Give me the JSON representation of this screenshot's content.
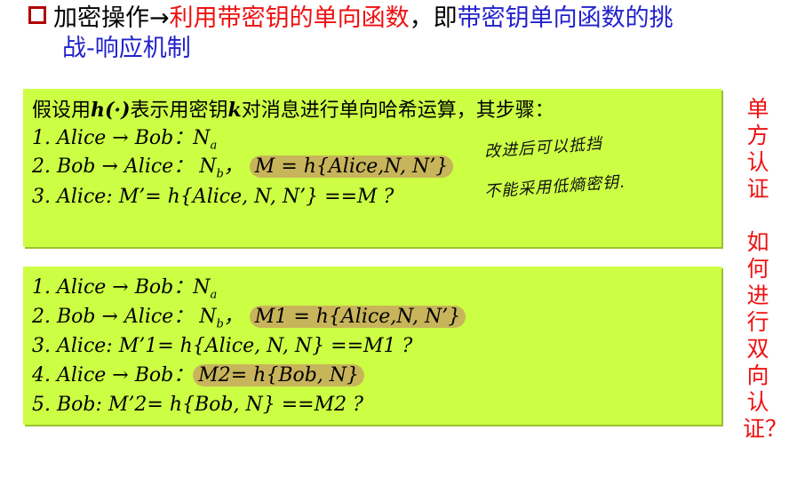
{
  "heading": {
    "part1": "加密操作→",
    "part2": "利用带密钥的单向函数",
    "part3": "，即",
    "part4": "带密钥单向函数的挑",
    "part5": "战-响应机制"
  },
  "box1": {
    "intro_a": "假设用",
    "intro_h": "h(·)",
    "intro_b": "表示用密钥",
    "intro_k": "k",
    "intro_c": "对消息进行单向哈希运算，其步骤：",
    "step1": "1. Alice → Bob：N",
    "step1_sub": "a",
    "step2_pre": "2. Bob → Alice： N",
    "step2_sub": "b",
    "step2_comma": "，",
    "step2_hl": "M = h{Alice,N, N’}",
    "step3": "3. Alice: M’= h{Alice, N, N’} ==M ?"
  },
  "notes": {
    "line1": "改进后可以抵挡",
    "line2": "不能采用低熵密钥."
  },
  "box2": {
    "step1": "1. Alice → Bob：N",
    "step1_sub": "a",
    "step2_pre": "2. Bob → Alice： N",
    "step2_sub": "b",
    "step2_comma": "，",
    "step2_hl": "M1 = h{Alice,N, N’}",
    "step3": "3. Alice: M’1= h{Alice, N, N} ==M1 ?",
    "step4_pre": "4. Alice → Bob：",
    "step4_hl": "M2= h{Bob, N}",
    "step5": "5. Bob: M’2= h{Bob, N} ==M2 ?"
  },
  "side": {
    "top": "单方认证",
    "bottom": "如何进行双向认证？"
  }
}
